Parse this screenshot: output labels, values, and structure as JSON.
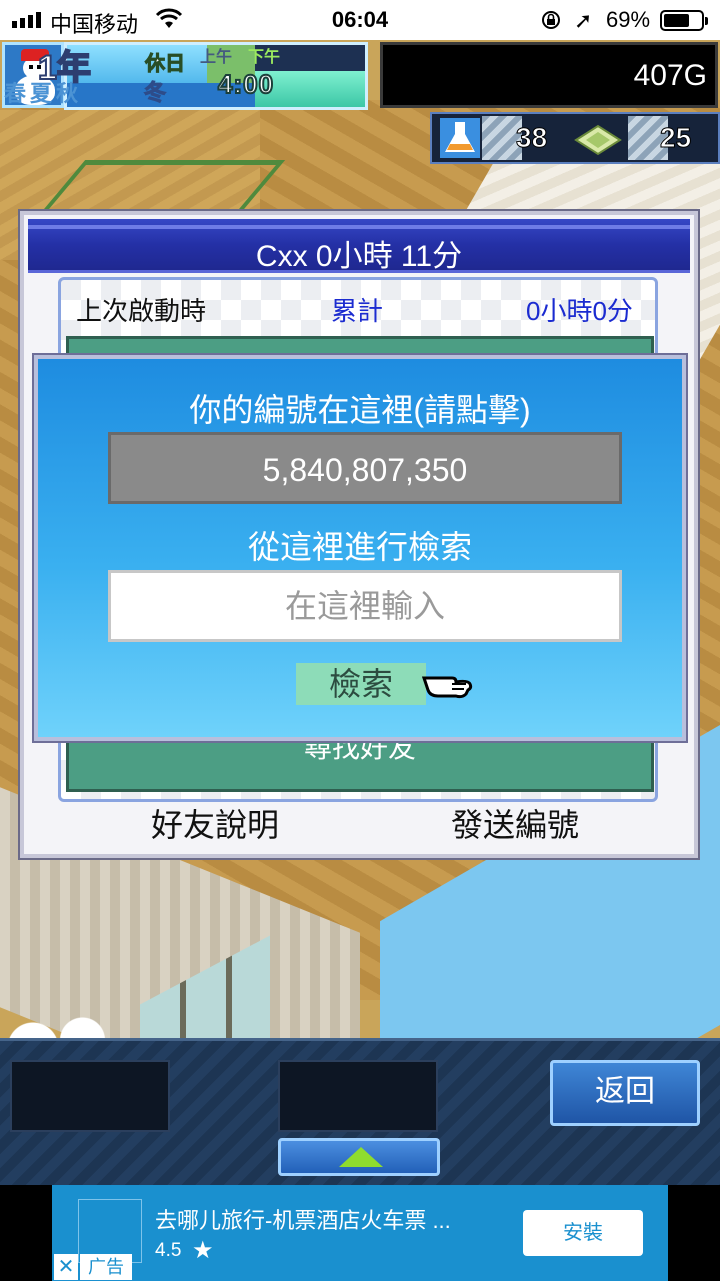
{
  "status_bar": {
    "carrier": "中国移动",
    "time": "06:04",
    "battery_percent": "69%",
    "battery_level": 0.69,
    "icons": [
      "signal-icon",
      "wifi-icon",
      "rotation-lock-icon",
      "location-icon",
      "battery-icon"
    ]
  },
  "hud": {
    "year": "1年",
    "day_off": "休日",
    "am": "上午",
    "pm": "下午",
    "season_dim": "春夏秋",
    "season": "冬",
    "clock": "4:00",
    "gold": "407G",
    "resource_1": "38",
    "resource_2": "25"
  },
  "friend_panel": {
    "title": "Cxx  0小時 11分",
    "last_launch_label": "上次啟動時",
    "total_label": "累計",
    "total_time": "0小時0分",
    "find_friend": "尋找好友",
    "friend_help_button": "好友說明",
    "send_id_button": "發送編號"
  },
  "id_popup": {
    "prompt": "你的編號在這裡(請點擊)",
    "id_value": "5,840,807,350",
    "search_prompt": "從這裡進行檢索",
    "search_placeholder": "在這裡輸入",
    "search_value": "",
    "search_button": "檢索"
  },
  "bottom_bar": {
    "back_button": "返回"
  },
  "ad": {
    "title": "去哪儿旅行-机票酒店火车票 ...",
    "rating": "4.5",
    "star": "★",
    "install_button": "安裝",
    "close": "✕",
    "label": "广告"
  },
  "colors": {
    "popup_blue": "#1e8ce0",
    "header_blue": "#2430a6",
    "list_green": "#4c9e84",
    "accent_link": "#1b2bd0",
    "ad_blue": "#1a90cf"
  }
}
